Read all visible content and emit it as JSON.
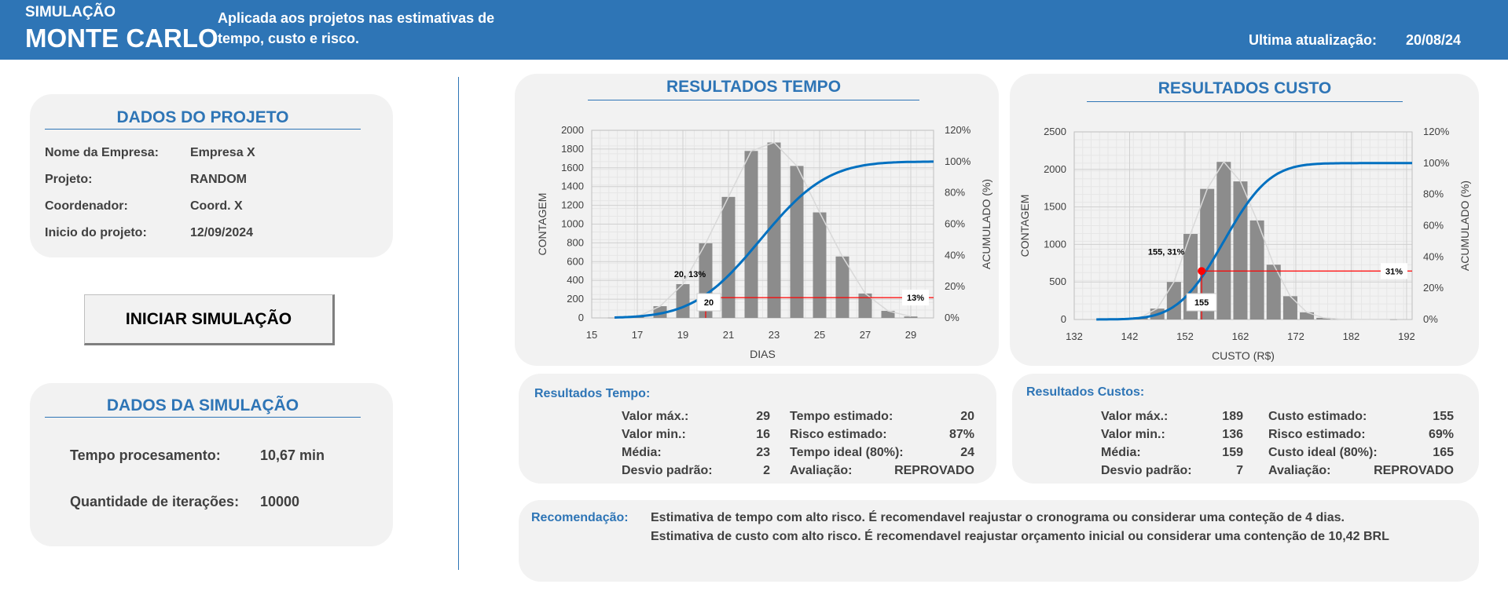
{
  "header": {
    "brand_sub": "SIMULAÇÃO",
    "brand_main": "MONTE CARLO",
    "tagline": "Aplicada aos projetos nas estimativas de tempo, custo e risco.",
    "update_label": "Ultima atualização:",
    "update_value": "20/08/24"
  },
  "project": {
    "title": "DADOS DO PROJETO",
    "rows": [
      {
        "label": "Nome da Empresa:",
        "value": "Empresa X"
      },
      {
        "label": "Projeto:",
        "value": "RANDOM"
      },
      {
        "label": "Coordenador:",
        "value": "Coord. X"
      },
      {
        "label": "Inicio do projeto:",
        "value": "12/09/2024"
      }
    ]
  },
  "button": {
    "label": "INICIAR SIMULAÇÃO"
  },
  "simulation": {
    "title": "DADOS DA SIMULAÇÃO",
    "rows": [
      {
        "label": "Tempo procesamento:",
        "value": "10,67 min"
      },
      {
        "label": "Quantidade de iterações:",
        "value": "10000"
      }
    ]
  },
  "time_chart": {
    "title": "RESULTADOS TEMPO",
    "point_label": "20, 13%",
    "marker_x_label": "20",
    "marker_pct_label": "13%"
  },
  "cost_chart": {
    "title": "RESULTADOS CUSTO",
    "point_label": "155, 31%",
    "marker_x_label": "155",
    "marker_pct_label": "31%"
  },
  "chart_data": [
    {
      "type": "bar",
      "xlabel": "DIAS",
      "ylabel": "CONTAGEM",
      "y2label": "ACUMULADO (%)",
      "xlim": [
        15,
        30
      ],
      "xticks": [
        15,
        17,
        19,
        21,
        23,
        25,
        27,
        29
      ],
      "ylim": [
        0,
        2000
      ],
      "yticks": [
        0,
        200,
        400,
        600,
        800,
        1000,
        1200,
        1400,
        1600,
        1800,
        2000
      ],
      "y2lim": [
        0,
        120
      ],
      "y2ticks": [
        "0%",
        "20%",
        "40%",
        "60%",
        "80%",
        "100%",
        "120%"
      ],
      "bars": {
        "x": [
          16,
          17,
          18,
          19,
          20,
          21,
          22,
          23,
          24,
          25,
          26,
          27,
          28,
          29
        ],
        "values": [
          2,
          12,
          125,
          360,
          795,
          1290,
          1780,
          1870,
          1620,
          1125,
          655,
          260,
          75,
          15
        ]
      },
      "cumulative_mean": 22.4,
      "cumulative_sd": 2.3,
      "cumulative_start": 16,
      "marker": {
        "x": 20,
        "pct": 13
      },
      "grid": true
    },
    {
      "type": "bar",
      "xlabel": "CUSTO (R$)",
      "ylabel": "CONTAGEM",
      "y2label": "ACUMULADO (%)",
      "xlim": [
        132,
        193
      ],
      "xticks": [
        132,
        142,
        152,
        162,
        172,
        182,
        192
      ],
      "ylim": [
        0,
        2500
      ],
      "yticks": [
        0,
        500,
        1000,
        1500,
        2000,
        2500
      ],
      "y2lim": [
        0,
        120
      ],
      "y2ticks": [
        "0%",
        "20%",
        "40%",
        "60%",
        "80%",
        "100%",
        "120%"
      ],
      "bars": {
        "x": [
          141,
          144,
          147,
          150,
          153,
          156,
          159,
          162,
          165,
          168,
          171,
          174,
          177,
          180,
          183,
          186,
          189
        ],
        "values": [
          5,
          30,
          145,
          500,
          1140,
          1740,
          2100,
          1840,
          1320,
          730,
          310,
          95,
          22,
          5,
          2,
          1,
          1
        ]
      },
      "cumulative_mean": 159,
      "cumulative_sd": 6.5,
      "cumulative_start": 136,
      "marker": {
        "x": 155,
        "pct": 31
      },
      "grid": true
    }
  ],
  "time_results": {
    "title": "Resultados Tempo:",
    "left": [
      {
        "label": "Valor máx.:",
        "value": "29"
      },
      {
        "label": "Valor min.:",
        "value": "16"
      },
      {
        "label": "Média:",
        "value": "23"
      },
      {
        "label": "Desvio padrão:",
        "value": "2"
      }
    ],
    "right": [
      {
        "label": "Tempo estimado:",
        "value": "20"
      },
      {
        "label": "Risco estimado:",
        "value": "87%"
      },
      {
        "label": "Tempo ideal (80%):",
        "value": "24"
      },
      {
        "label": "Avaliação:",
        "value": "REPROVADO"
      }
    ]
  },
  "cost_results": {
    "title": "Resultados Custos:",
    "left": [
      {
        "label": "Valor máx.:",
        "value": "189"
      },
      {
        "label": "Valor min.:",
        "value": "136"
      },
      {
        "label": "Média:",
        "value": "159"
      },
      {
        "label": "Desvio padrão:",
        "value": "7"
      }
    ],
    "right": [
      {
        "label": "Custo estimado:",
        "value": "155"
      },
      {
        "label": "Risco estimado:",
        "value": "69%"
      },
      {
        "label": "Custo ideal (80%):",
        "value": "165"
      },
      {
        "label": "Avaliação:",
        "value": "REPROVADO"
      }
    ]
  },
  "recommendation": {
    "label": "Recomendação:",
    "lines": [
      "Estimativa de tempo com alto risco. É recomendavel reajustar o cronograma ou considerar uma conteção de 4 dias.",
      "Estimativa de custo com alto risco. É recomendavel reajustar orçamento inicial ou considerar uma contenção de 10,42 BRL"
    ]
  },
  "colors": {
    "header": "#2e75b6",
    "accent": "#2e75b6",
    "panel": "#f2f2f2",
    "bar": "#8c8c8c",
    "curve": "#0070c0",
    "marker": "#ff0000"
  }
}
